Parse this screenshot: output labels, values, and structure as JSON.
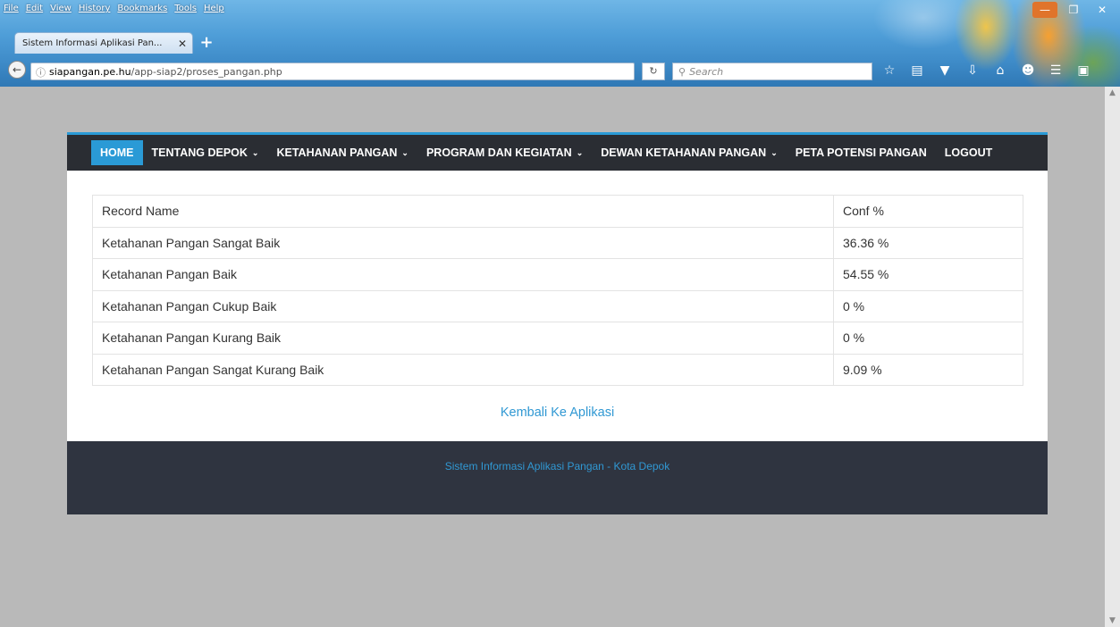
{
  "browser": {
    "menu": [
      "File",
      "Edit",
      "View",
      "History",
      "Bookmarks",
      "Tools",
      "Help"
    ],
    "tab_title": "Sistem Informasi Aplikasi Pan...",
    "url_host": "siapangan.pe.hu",
    "url_path": "/app-siap2/proses_pangan.php",
    "search_placeholder": "Search"
  },
  "nav": {
    "items": [
      {
        "label": "HOME",
        "active": true,
        "dropdown": false
      },
      {
        "label": "TENTANG DEPOK",
        "active": false,
        "dropdown": true
      },
      {
        "label": "KETAHANAN PANGAN",
        "active": false,
        "dropdown": true
      },
      {
        "label": "PROGRAM DAN KEGIATAN",
        "active": false,
        "dropdown": true
      },
      {
        "label": "DEWAN KETAHANAN PANGAN",
        "active": false,
        "dropdown": true
      },
      {
        "label": "PETA POTENSI PANGAN",
        "active": false,
        "dropdown": false
      },
      {
        "label": "LOGOUT",
        "active": false,
        "dropdown": false
      }
    ],
    "accent_color": "#2a9ad6"
  },
  "table": {
    "header": [
      "Record Name",
      "Conf %"
    ],
    "rows": [
      [
        "Ketahanan Pangan Sangat Baik",
        "36.36 %"
      ],
      [
        "Ketahanan Pangan Baik",
        "54.55 %"
      ],
      [
        "Ketahanan Pangan Cukup Baik",
        "0 %"
      ],
      [
        "Ketahanan Pangan Kurang Baik",
        "0 %"
      ],
      [
        "Ketahanan Pangan Sangat Kurang Baik",
        "9.09 %"
      ]
    ]
  },
  "back_link": "Kembali Ke Aplikasi",
  "footer_text": "Sistem Informasi Aplikasi Pangan - Kota Depok"
}
